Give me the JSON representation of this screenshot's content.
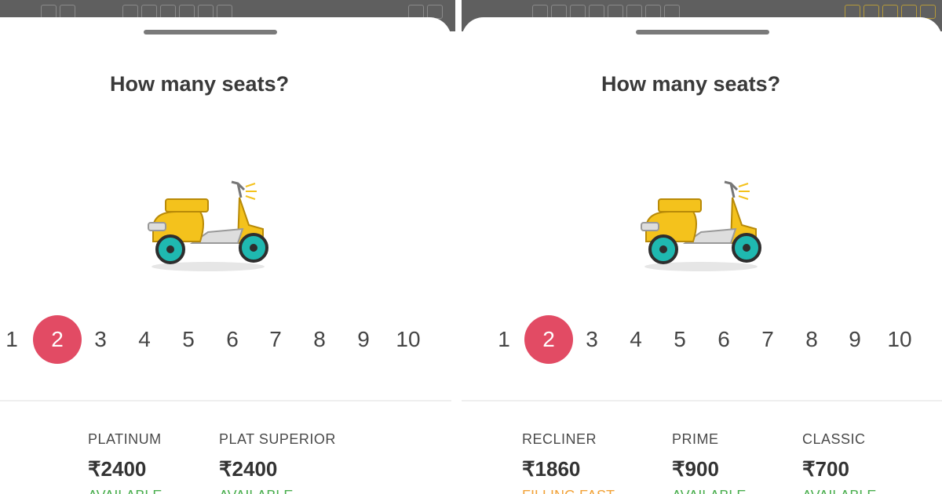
{
  "colors": {
    "selected": "#e24b64",
    "available": "#4caf50",
    "filling_fast": "#f2a33a",
    "scooter_body": "#f4c21c",
    "scooter_wheel": "#1fb8b0"
  },
  "icons": {
    "scooter": "scooter-icon"
  },
  "screens": [
    {
      "title": "How many seats?",
      "seat_counts": [
        "1",
        "2",
        "3",
        "4",
        "5",
        "6",
        "7",
        "8",
        "9",
        "10"
      ],
      "selected_count": "2",
      "categories": [
        {
          "name": "PLATINUM",
          "price": "₹2400",
          "status": "AVAILABLE",
          "status_type": "available"
        },
        {
          "name": "PLAT SUPERIOR",
          "price": "₹2400",
          "status": "AVAILABLE",
          "status_type": "available"
        }
      ]
    },
    {
      "title": "How many seats?",
      "seat_counts": [
        "1",
        "2",
        "3",
        "4",
        "5",
        "6",
        "7",
        "8",
        "9",
        "10"
      ],
      "selected_count": "2",
      "categories": [
        {
          "name": "RECLINER",
          "price": "₹1860",
          "status": "FILLING FAST",
          "status_type": "filling_fast"
        },
        {
          "name": "PRIME",
          "price": "₹900",
          "status": "AVAILABLE",
          "status_type": "available"
        },
        {
          "name": "CLASSIC",
          "price": "₹700",
          "status": "AVAILABLE",
          "status_type": "available"
        }
      ]
    }
  ]
}
